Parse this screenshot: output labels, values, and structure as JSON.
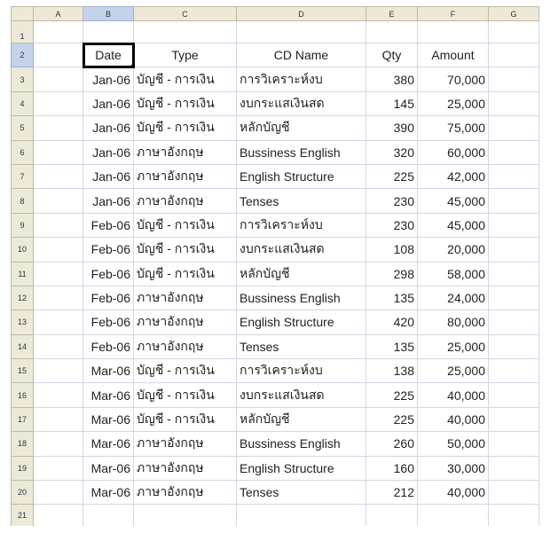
{
  "columns": [
    "A",
    "B",
    "C",
    "D",
    "E",
    "F",
    "G"
  ],
  "selected_column": "B",
  "selected_row": "2",
  "active_cell": "B2",
  "row_numbers": [
    "1",
    "2",
    "3",
    "4",
    "5",
    "6",
    "7",
    "8",
    "9",
    "10",
    "11",
    "12",
    "13",
    "14",
    "15",
    "16",
    "17",
    "18",
    "19",
    "20",
    "21"
  ],
  "headers": {
    "date": "Date",
    "type": "Type",
    "cd_name": "CD Name",
    "qty": "Qty",
    "amount": "Amount"
  },
  "rows": [
    {
      "date": "Jan-06",
      "type": "บัญชี - การเงิน",
      "cd_name": "การวิเคราะห์งบ",
      "qty": "380",
      "amount": "70,000"
    },
    {
      "date": "Jan-06",
      "type": "บัญชี - การเงิน",
      "cd_name": "งบกระแสเงินสด",
      "qty": "145",
      "amount": "25,000"
    },
    {
      "date": "Jan-06",
      "type": "บัญชี - การเงิน",
      "cd_name": "หลักบัญชี",
      "qty": "390",
      "amount": "75,000"
    },
    {
      "date": "Jan-06",
      "type": "ภาษาอังกฤษ",
      "cd_name": "Bussiness English",
      "qty": "320",
      "amount": "60,000"
    },
    {
      "date": "Jan-06",
      "type": "ภาษาอังกฤษ",
      "cd_name": "English Structure",
      "qty": "225",
      "amount": "42,000"
    },
    {
      "date": "Jan-06",
      "type": "ภาษาอังกฤษ",
      "cd_name": "Tenses",
      "qty": "230",
      "amount": "45,000"
    },
    {
      "date": "Feb-06",
      "type": "บัญชี - การเงิน",
      "cd_name": "การวิเคราะห์งบ",
      "qty": "230",
      "amount": "45,000"
    },
    {
      "date": "Feb-06",
      "type": "บัญชี - การเงิน",
      "cd_name": "งบกระแสเงินสด",
      "qty": "108",
      "amount": "20,000"
    },
    {
      "date": "Feb-06",
      "type": "บัญชี - การเงิน",
      "cd_name": "หลักบัญชี",
      "qty": "298",
      "amount": "58,000"
    },
    {
      "date": "Feb-06",
      "type": "ภาษาอังกฤษ",
      "cd_name": "Bussiness English",
      "qty": "135",
      "amount": "24,000"
    },
    {
      "date": "Feb-06",
      "type": "ภาษาอังกฤษ",
      "cd_name": "English Structure",
      "qty": "420",
      "amount": "80,000"
    },
    {
      "date": "Feb-06",
      "type": "ภาษาอังกฤษ",
      "cd_name": "Tenses",
      "qty": "135",
      "amount": "25,000"
    },
    {
      "date": "Mar-06",
      "type": "บัญชี - การเงิน",
      "cd_name": "การวิเคราะห์งบ",
      "qty": "138",
      "amount": "25,000"
    },
    {
      "date": "Mar-06",
      "type": "บัญชี - การเงิน",
      "cd_name": "งบกระแสเงินสด",
      "qty": "225",
      "amount": "40,000"
    },
    {
      "date": "Mar-06",
      "type": "บัญชี - การเงิน",
      "cd_name": "หลักบัญชี",
      "qty": "225",
      "amount": "40,000"
    },
    {
      "date": "Mar-06",
      "type": "ภาษาอังกฤษ",
      "cd_name": "Bussiness English",
      "qty": "260",
      "amount": "50,000"
    },
    {
      "date": "Mar-06",
      "type": "ภาษาอังกฤษ",
      "cd_name": "English Structure",
      "qty": "160",
      "amount": "30,000"
    },
    {
      "date": "Mar-06",
      "type": "ภาษาอังกฤษ",
      "cd_name": "Tenses",
      "qty": "212",
      "amount": "40,000"
    }
  ]
}
